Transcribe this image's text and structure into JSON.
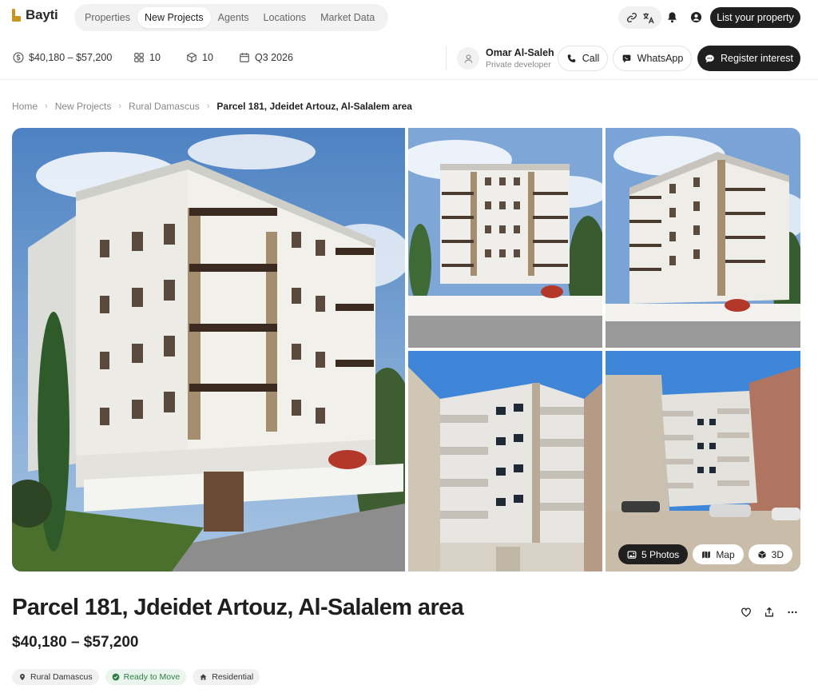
{
  "brand": {
    "name": "Bayti",
    "accent": "#c8961f"
  },
  "nav": {
    "items": [
      {
        "label": "Properties",
        "active": false
      },
      {
        "label": "New Projects",
        "active": true
      },
      {
        "label": "Agents",
        "active": false
      },
      {
        "label": "Locations",
        "active": false
      },
      {
        "label": "Market Data",
        "active": false
      }
    ],
    "list_button": "List your property",
    "icons": [
      "link-icon",
      "translate-icon",
      "bell-icon",
      "account-icon"
    ]
  },
  "stats": {
    "price_range": "$40,180 – $57,200",
    "units": "10",
    "buildings": "10",
    "delivery": "Q3 2026"
  },
  "agent": {
    "name": "Omar Al-Saleh",
    "role": "Private developer",
    "call_label": "Call",
    "whatsapp_label": "WhatsApp",
    "register_label": "Register interest"
  },
  "breadcrumb": {
    "items": [
      "Home",
      "New Projects",
      "Rural Damascus"
    ],
    "current": "Parcel 181, Jdeidet Artouz, Al-Salalem area"
  },
  "gallery": {
    "photos_label": "5 Photos",
    "map_label": "Map",
    "threed_label": "3D",
    "photo_count": 5
  },
  "listing": {
    "title": "Parcel 181, Jdeidet Artouz, Al-Salalem area",
    "price": "$40,180 – $57,200",
    "tags": [
      {
        "label": "Rural Damascus",
        "icon": "location-pin-icon",
        "style": "neutral"
      },
      {
        "label": "Ready to Move",
        "icon": "check-circle-icon",
        "style": "success"
      },
      {
        "label": "Residential",
        "icon": "house-icon",
        "style": "neutral"
      }
    ]
  },
  "colors": {
    "primary_dark": "#1f1f1f",
    "success_text": "#2b7d45",
    "success_bg": "#eaf5ed",
    "chip_bg": "#f1f1f1"
  }
}
